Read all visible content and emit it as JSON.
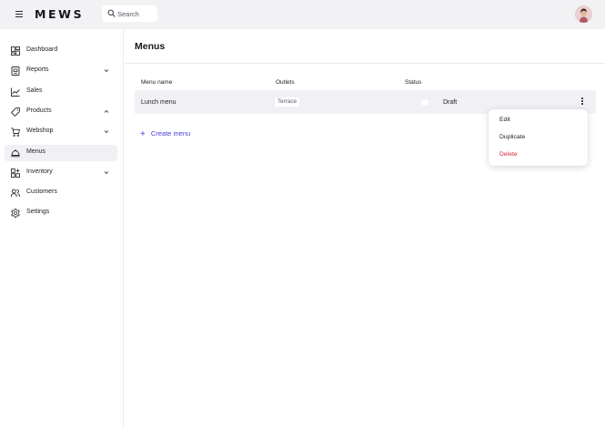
{
  "app": {
    "logo": "MEWS"
  },
  "search": {
    "placeholder": "Search"
  },
  "sidebar": {
    "items": [
      {
        "label": "Dashboard",
        "icon": "dashboard-icon",
        "chevron": ""
      },
      {
        "label": "Reports",
        "icon": "reports-icon",
        "chevron": "down"
      },
      {
        "label": "Sales",
        "icon": "sales-icon",
        "chevron": ""
      },
      {
        "label": "Products",
        "icon": "tag-icon",
        "chevron": "up"
      },
      {
        "label": "Webshop",
        "icon": "cart-icon",
        "chevron": "down"
      },
      {
        "label": "Menus",
        "icon": "cloche-icon",
        "chevron": "",
        "active": true
      },
      {
        "label": "Inventory",
        "icon": "inventory-icon",
        "chevron": "down"
      },
      {
        "label": "Customers",
        "icon": "customers-icon",
        "chevron": ""
      },
      {
        "label": "Settings",
        "icon": "gear-icon",
        "chevron": ""
      }
    ]
  },
  "main": {
    "title": "Menus",
    "table": {
      "columns": [
        "Menu name",
        "Outlets",
        "Status"
      ],
      "rows": [
        {
          "name": "Lunch menu",
          "outlet": "Terrace",
          "status": "Draft",
          "enabled": false
        }
      ]
    },
    "create_label": "Create menu"
  },
  "context_menu": {
    "items": [
      "Edit",
      "Duplicate",
      "Delete"
    ]
  },
  "colors": {
    "accent": "#4b3fd8",
    "danger": "#e0263d",
    "topbar": "#f2f2f4",
    "active_bg": "#f0f0f5"
  }
}
